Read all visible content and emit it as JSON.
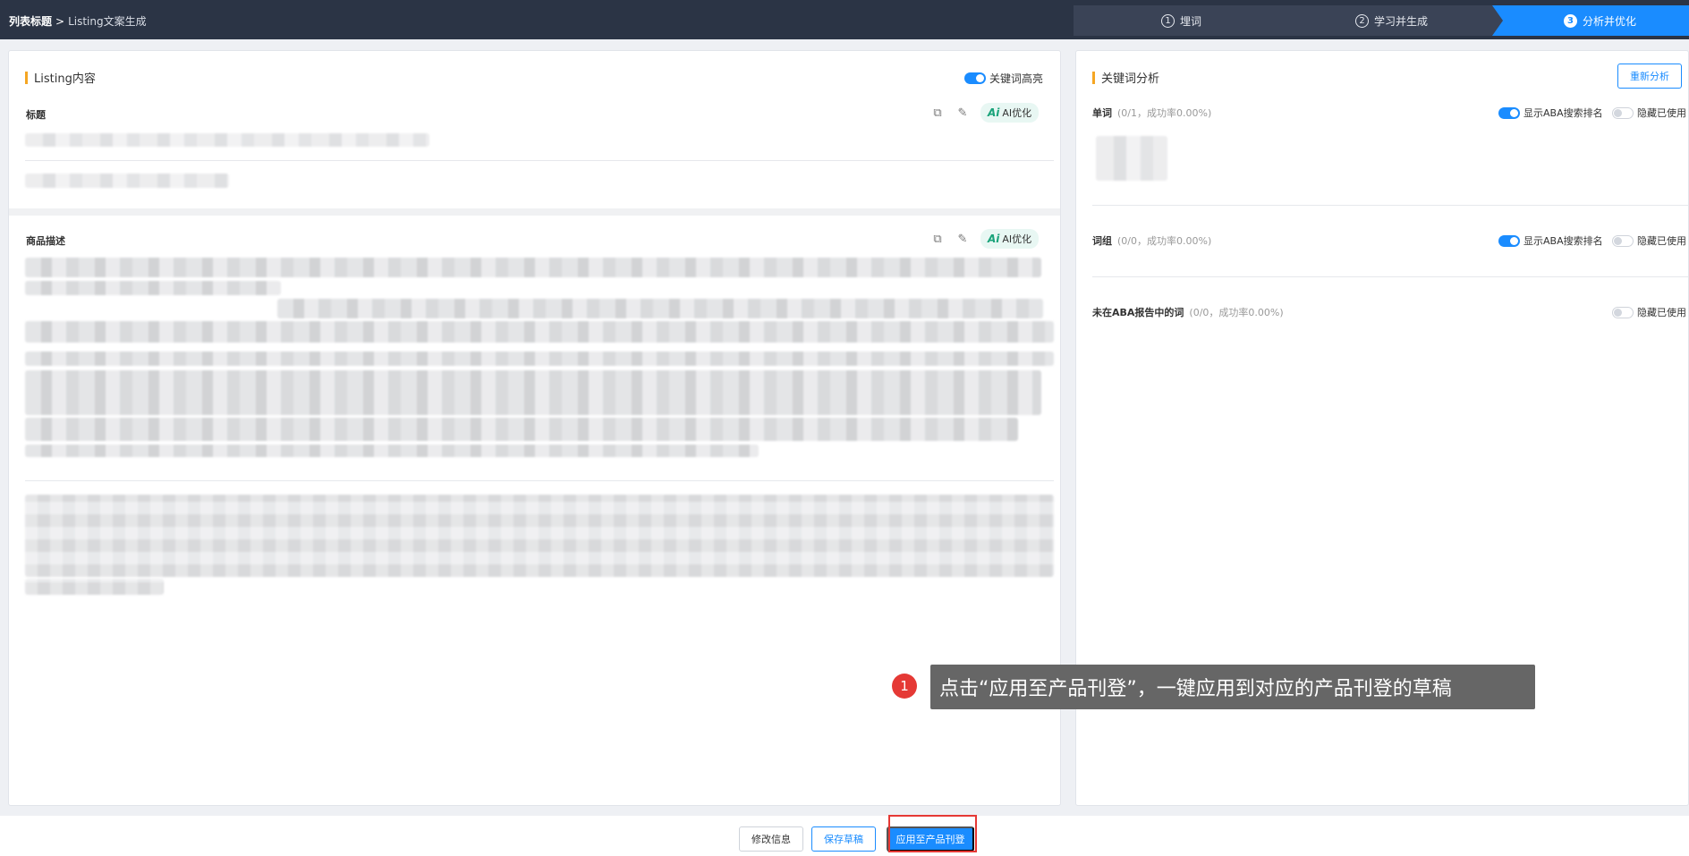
{
  "header": {
    "breadcrumb_root": "列表标题",
    "breadcrumb_sep": ">",
    "breadcrumb_current": "Listing文案生成",
    "steps": [
      {
        "num": "1",
        "label": "埋词"
      },
      {
        "num": "2",
        "label": "学习并生成"
      },
      {
        "num": "3",
        "label": "分析并优化"
      }
    ]
  },
  "left": {
    "title": "Listing内容",
    "highlight_toggle_label": "关键词高亮",
    "title_field_label": "标题",
    "desc_field_label": "商品描述",
    "ai_label": "AI优化",
    "ai_glyph": "Ai",
    "copy_icon": "⧉",
    "edit_icon": "✎"
  },
  "right": {
    "title": "关键词分析",
    "reanalyze": "重新分析",
    "single": {
      "name": "单词",
      "stat": "(0/1，成功率0.00%)"
    },
    "phrase": {
      "name": "词组",
      "stat": "(0/0，成功率0.00%)"
    },
    "not_in_aba": {
      "name": "未在ABA报告中的词",
      "stat": "(0/0，成功率0.00%)"
    },
    "show_aba_rank": "显示ABA搜索排名",
    "hide_used": "隐藏已使用"
  },
  "footer": {
    "edit_info": "修改信息",
    "save_draft": "保存草稿",
    "apply": "应用至产品刊登"
  },
  "tooltip": {
    "num": "1",
    "text": "点击“应用至产品刊登”，一键应用到对应的产品刊登的草稿"
  },
  "colors": {
    "primary": "#1a8cff",
    "accent": "#f5a623",
    "annotation_red": "#e53935"
  }
}
